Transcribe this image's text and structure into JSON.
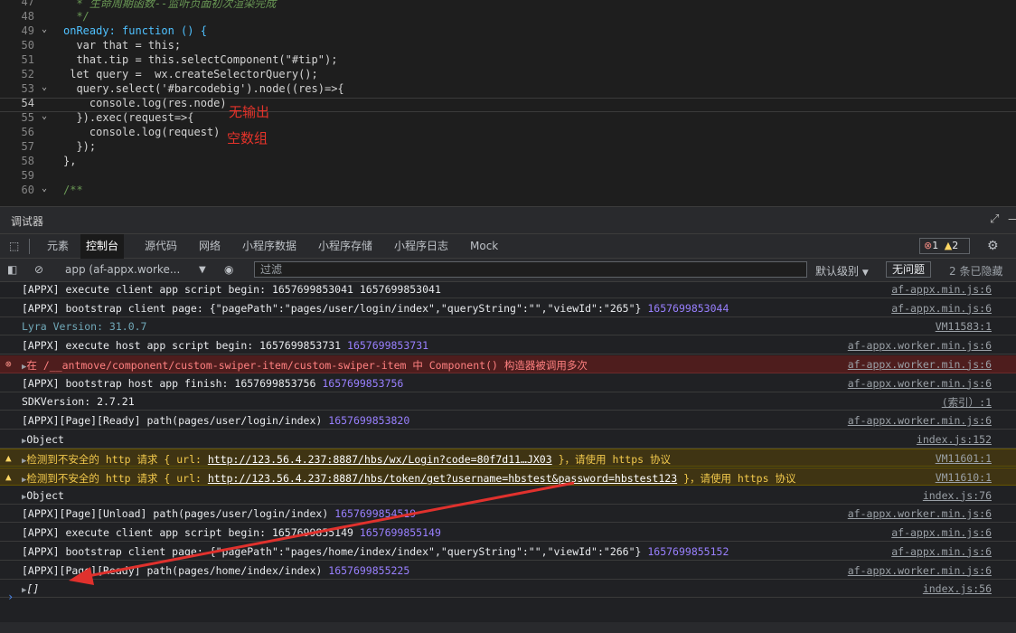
{
  "editor": {
    "lines": [
      {
        "n": "47",
        "text": "  * 生命周期函数--监听页面初次渲染完成"
      },
      {
        "n": "48",
        "text": "  */"
      },
      {
        "n": "49",
        "text": "onReady: function () {"
      },
      {
        "n": "50",
        "text": "  var that = this;"
      },
      {
        "n": "51",
        "text": "  that.tip = this.selectComponent(\"#tip\");"
      },
      {
        "n": "52",
        "text": " let query =  wx.createSelectorQuery();"
      },
      {
        "n": "53",
        "text": "  query.select('#barcodebig').node((res)=>{"
      },
      {
        "n": "54",
        "text": "    console.log(res.node)"
      },
      {
        "n": "55",
        "text": "  }).exec(request=>{"
      },
      {
        "n": "56",
        "text": "    console.log(request)"
      },
      {
        "n": "57",
        "text": "  });"
      },
      {
        "n": "58",
        "text": "},"
      },
      {
        "n": "59",
        "text": ""
      },
      {
        "n": "60",
        "text": "/**"
      }
    ],
    "annotations": {
      "no_output": "无输出",
      "empty_array": "空数组"
    }
  },
  "debugger": {
    "title": "调试器",
    "tabs": [
      "元素",
      "控制台",
      "源代码",
      "网络",
      "小程序数据",
      "小程序存储",
      "小程序日志",
      "Mock"
    ],
    "active_tab": "控制台",
    "error_count": "1",
    "warning_count": "2",
    "context": "app (af-appx.worke...",
    "filter_placeholder": "过滤",
    "level": "默认级别",
    "no_issues": "无问题",
    "hidden": "2 条已隐藏"
  },
  "console": {
    "rows": [
      {
        "type": "log",
        "msg": "[APPX] execute client app script begin: 1657699853041 1657699853041",
        "src": "af-appx.min.js:6"
      },
      {
        "type": "log",
        "msg": "[APPX] bootstrap client page: {\"pagePath\":\"pages/user/login/index\",\"queryString\":\"\",\"viewId\":\"265\"} ",
        "ts": "1657699853044",
        "src": "af-appx.min.js:6"
      },
      {
        "type": "dim",
        "msg": "Lyra Version: 31.0.7",
        "src": "VM11583:1"
      },
      {
        "type": "log",
        "msg": "[APPX] execute host app script begin: 1657699853731 ",
        "ts": "1657699853731",
        "src": "af-appx.worker.min.js:6"
      },
      {
        "type": "err",
        "msg": "在 /__antmove/component/custom-swiper-item/custom-swiper-item 中 Component() 构造器被调用多次",
        "src": "af-appx.worker.min.js:6"
      },
      {
        "type": "log",
        "msg": "[APPX] bootstrap host app finish: 1657699853756 ",
        "ts": "1657699853756",
        "src": "af-appx.worker.min.js:6"
      },
      {
        "type": "log",
        "msg": "SDKVersion: 2.7.21",
        "src": "(索引）:1"
      },
      {
        "type": "log",
        "msg": "[APPX][Page][Ready] path(pages/user/login/index) ",
        "ts": "1657699853820",
        "src": "af-appx.worker.min.js:6"
      },
      {
        "type": "obj",
        "msg": "Object",
        "src": "index.js:152"
      },
      {
        "type": "warn",
        "pre": "检测到不安全的 http 请求 { url: ",
        "url": "http://123.56.4.237:8887/hbs/wx/Login?code=80f7d11…JX03",
        "post": " }，请使用 https 协议",
        "src": "VM11601:1"
      },
      {
        "type": "warn",
        "pre": "检测到不安全的 http 请求 { url: ",
        "url": "http://123.56.4.237:8887/hbs/token/get?username=hbstest&password=hbstest123",
        "post": " }，请使用 https 协议",
        "src": "VM11610:1"
      },
      {
        "type": "obj",
        "msg": "Object",
        "src": "index.js:76"
      },
      {
        "type": "log",
        "msg": "[APPX][Page][Unload] path(pages/user/login/index) ",
        "ts": "1657699854519",
        "src": "af-appx.worker.min.js:6"
      },
      {
        "type": "log",
        "msg": "[APPX] execute client app script begin: 1657699855149 ",
        "ts": "1657699855149",
        "src": "af-appx.min.js:6"
      },
      {
        "type": "log",
        "msg": "[APPX] bootstrap client page: {\"pagePath\":\"pages/home/index/index\",\"queryString\":\"\",\"viewId\":\"266\"} ",
        "ts": "1657699855152",
        "src": "af-appx.min.js:6"
      },
      {
        "type": "log",
        "msg": "[APPX][Page][Ready] path(pages/home/index/index) ",
        "ts": "1657699855225",
        "src": "af-appx.worker.min.js:6"
      },
      {
        "type": "arr",
        "msg": "[]",
        "src": "index.js:56"
      }
    ]
  },
  "colors": {
    "annotation": "#e5332a",
    "error_bg": "#4e1d1d",
    "warn_bg": "#3f3413",
    "timestamp": "#9980ff"
  }
}
